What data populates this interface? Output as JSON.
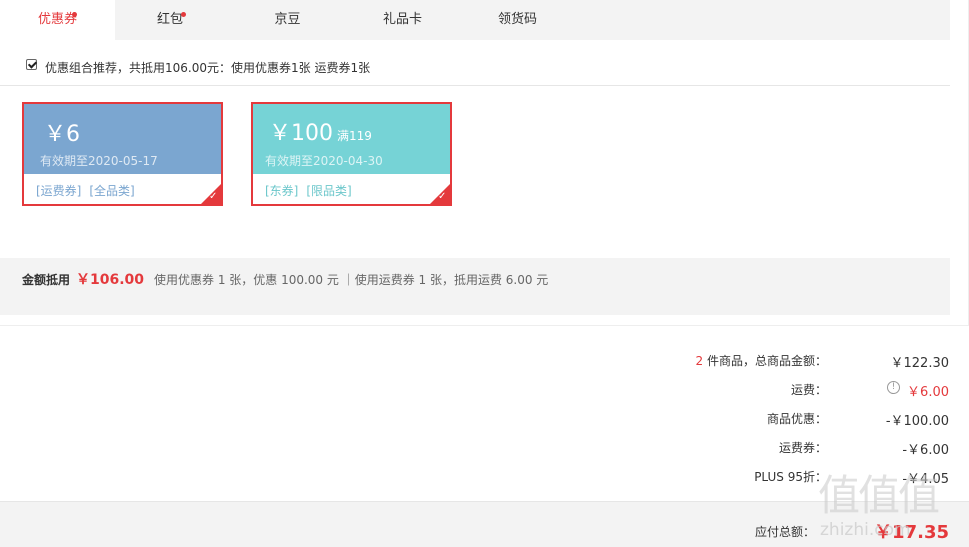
{
  "tabs": [
    {
      "label": "优惠券",
      "active": true,
      "dot": true
    },
    {
      "label": "红包",
      "active": false,
      "dot": true
    },
    {
      "label": "京豆",
      "active": false,
      "dot": false
    },
    {
      "label": "礼品卡",
      "active": false,
      "dot": false
    },
    {
      "label": "领货码",
      "active": false,
      "dot": false
    }
  ],
  "combo": {
    "checked": true,
    "text": "优惠组合推荐，共抵用106.00元：使用优惠券1张 运费券1张"
  },
  "coupons": [
    {
      "amount": "￥6",
      "condition": "",
      "valid": "有效期至2020-05-17",
      "tags": [
        "[运费券]",
        "[全品类]"
      ],
      "color": "#7ba6d0",
      "tag_color": "#7ba6d0",
      "selected": true
    },
    {
      "amount": "￥100",
      "condition": "满119",
      "valid": "有效期至2020-04-30",
      "tags": [
        "[东券]",
        "[限品类]"
      ],
      "color": "#76d3d6",
      "tag_color": "#6cc7cb",
      "selected": true
    }
  ],
  "summary": {
    "label": "金额抵用",
    "amount": "￥106.00",
    "detail": "使用优惠券 1 张，优惠 100.00 元 ｜使用运费券 1 张，抵用运费 6.00 元"
  },
  "totals": {
    "items_count": "2",
    "items_label": "件商品，总商品金额：",
    "items_value": "￥122.30",
    "shipping_label": "运费：",
    "shipping_value": "￥6.00",
    "discount_label": "商品优惠：",
    "discount_value": "-￥100.00",
    "shipping_coupon_label": "运费券：",
    "shipping_coupon_value": "-￥6.00",
    "plus_label": "PLUS 95折：",
    "plus_value": "-￥4.05"
  },
  "footer": {
    "label": "应付总额：",
    "value": "￥17.35"
  },
  "watermark": {
    "logo": "值值值",
    "text": "zhizhi.com"
  },
  "colors": {
    "accent": "#e4393c",
    "tab_bg": "#f3f3f3"
  },
  "icons": {
    "shipping_info": "info-icon",
    "coupon_selected": "check-icon"
  }
}
